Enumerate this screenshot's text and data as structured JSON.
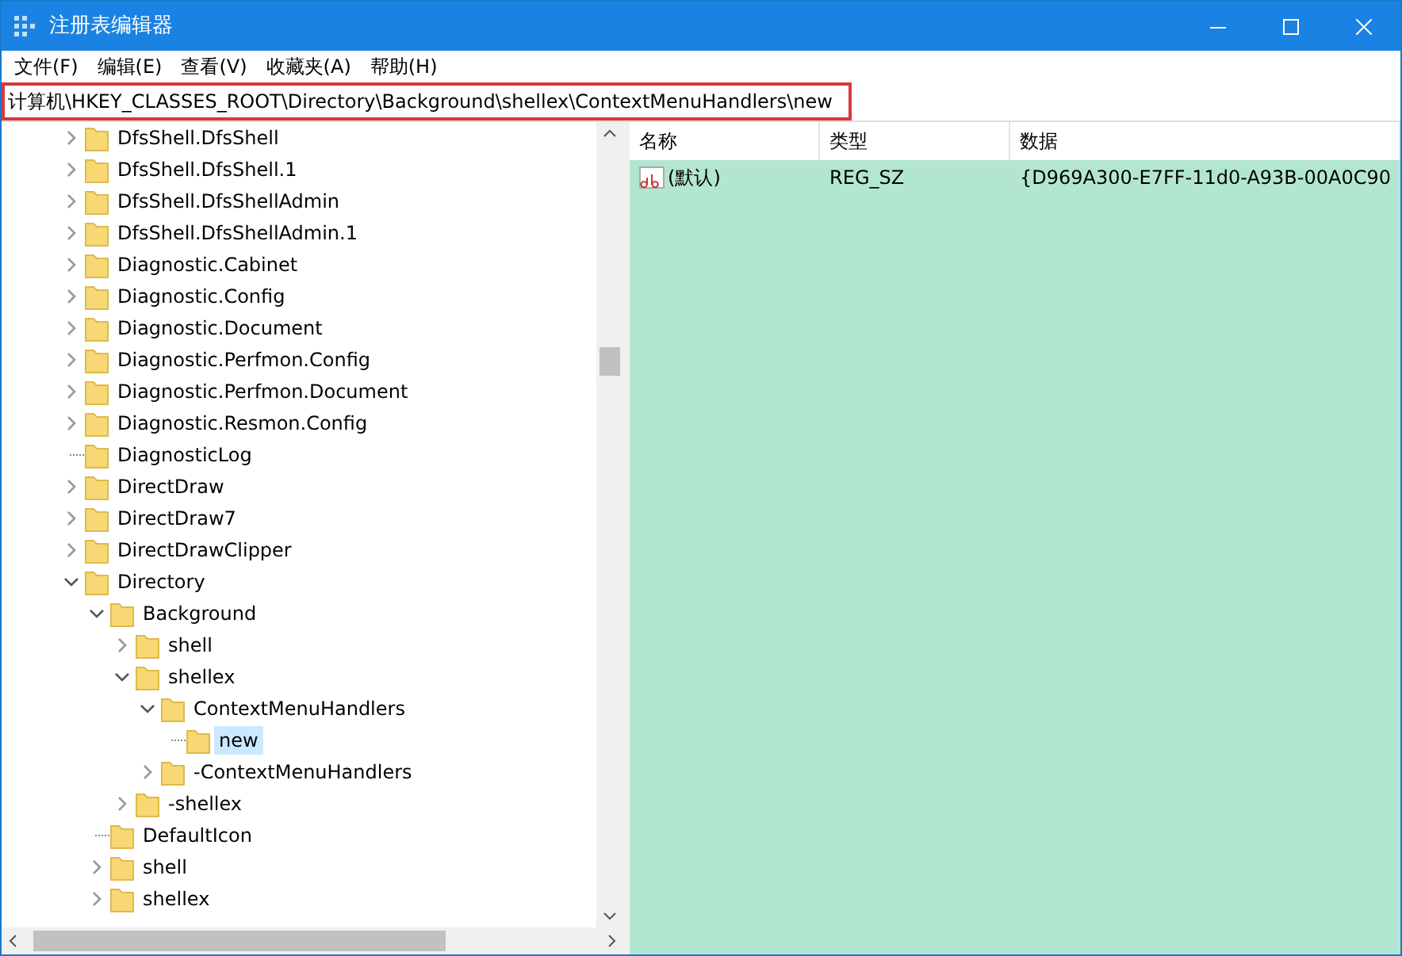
{
  "window": {
    "title": "注册表编辑器"
  },
  "menu": [
    "文件(F)",
    "编辑(E)",
    "查看(V)",
    "收藏夹(A)",
    "帮助(H)"
  ],
  "address": {
    "value": "计算机\\HKEY_CLASSES_ROOT\\Directory\\Background\\shellex\\ContextMenuHandlers\\new",
    "highlighted": true
  },
  "tree": [
    {
      "label": "DfsShell.DfsShell",
      "has_subkeys": true,
      "expanded": false,
      "selected": false
    },
    {
      "label": "DfsShell.DfsShell.1",
      "has_subkeys": true,
      "expanded": false,
      "selected": false
    },
    {
      "label": "DfsShell.DfsShellAdmin",
      "has_subkeys": true,
      "expanded": false,
      "selected": false
    },
    {
      "label": "DfsShell.DfsShellAdmin.1",
      "has_subkeys": true,
      "expanded": false,
      "selected": false
    },
    {
      "label": "Diagnostic.Cabinet",
      "has_subkeys": true,
      "expanded": false,
      "selected": false
    },
    {
      "label": "Diagnostic.Config",
      "has_subkeys": true,
      "expanded": false,
      "selected": false
    },
    {
      "label": "Diagnostic.Document",
      "has_subkeys": true,
      "expanded": false,
      "selected": false
    },
    {
      "label": "Diagnostic.Perfmon.Config",
      "has_subkeys": true,
      "expanded": false,
      "selected": false
    },
    {
      "label": "Diagnostic.Perfmon.Document",
      "has_subkeys": true,
      "expanded": false,
      "selected": false
    },
    {
      "label": "Diagnostic.Resmon.Config",
      "has_subkeys": true,
      "expanded": false,
      "selected": false
    },
    {
      "label": "DiagnosticLog",
      "has_subkeys": false,
      "selected": false
    },
    {
      "label": "DirectDraw",
      "has_subkeys": true,
      "expanded": false,
      "selected": false
    },
    {
      "label": "DirectDraw7",
      "has_subkeys": true,
      "expanded": false,
      "selected": false
    },
    {
      "label": "DirectDrawClipper",
      "has_subkeys": true,
      "expanded": false,
      "selected": false
    },
    {
      "label": "Directory",
      "has_subkeys": true,
      "expanded": true,
      "selected": false,
      "children": [
        {
          "label": "Background",
          "has_subkeys": true,
          "expanded": true,
          "selected": false,
          "children": [
            {
              "label": "shell",
              "has_subkeys": true,
              "expanded": false,
              "selected": false
            },
            {
              "label": "shellex",
              "has_subkeys": true,
              "expanded": true,
              "selected": false,
              "children": [
                {
                  "label": "ContextMenuHandlers",
                  "has_subkeys": true,
                  "expanded": true,
                  "selected": false,
                  "children": [
                    {
                      "label": "new",
                      "has_subkeys": false,
                      "selected": true
                    }
                  ]
                },
                {
                  "label": "-ContextMenuHandlers",
                  "has_subkeys": true,
                  "expanded": false,
                  "selected": false
                }
              ]
            },
            {
              "label": "-shellex",
              "has_subkeys": true,
              "expanded": false,
              "selected": false
            }
          ]
        },
        {
          "label": "DefaultIcon",
          "has_subkeys": false,
          "selected": false
        },
        {
          "label": "shell",
          "has_subkeys": true,
          "expanded": false,
          "selected": false
        },
        {
          "label": "shellex",
          "has_subkeys": true,
          "expanded": false,
          "selected": false
        }
      ]
    }
  ],
  "values": {
    "columns": [
      "名称",
      "类型",
      "数据"
    ],
    "rows": [
      {
        "name": "(默认)",
        "type": "REG_SZ",
        "data": "{D969A300-E7FF-11d0-A93B-00A0C90",
        "selected": true
      }
    ]
  }
}
